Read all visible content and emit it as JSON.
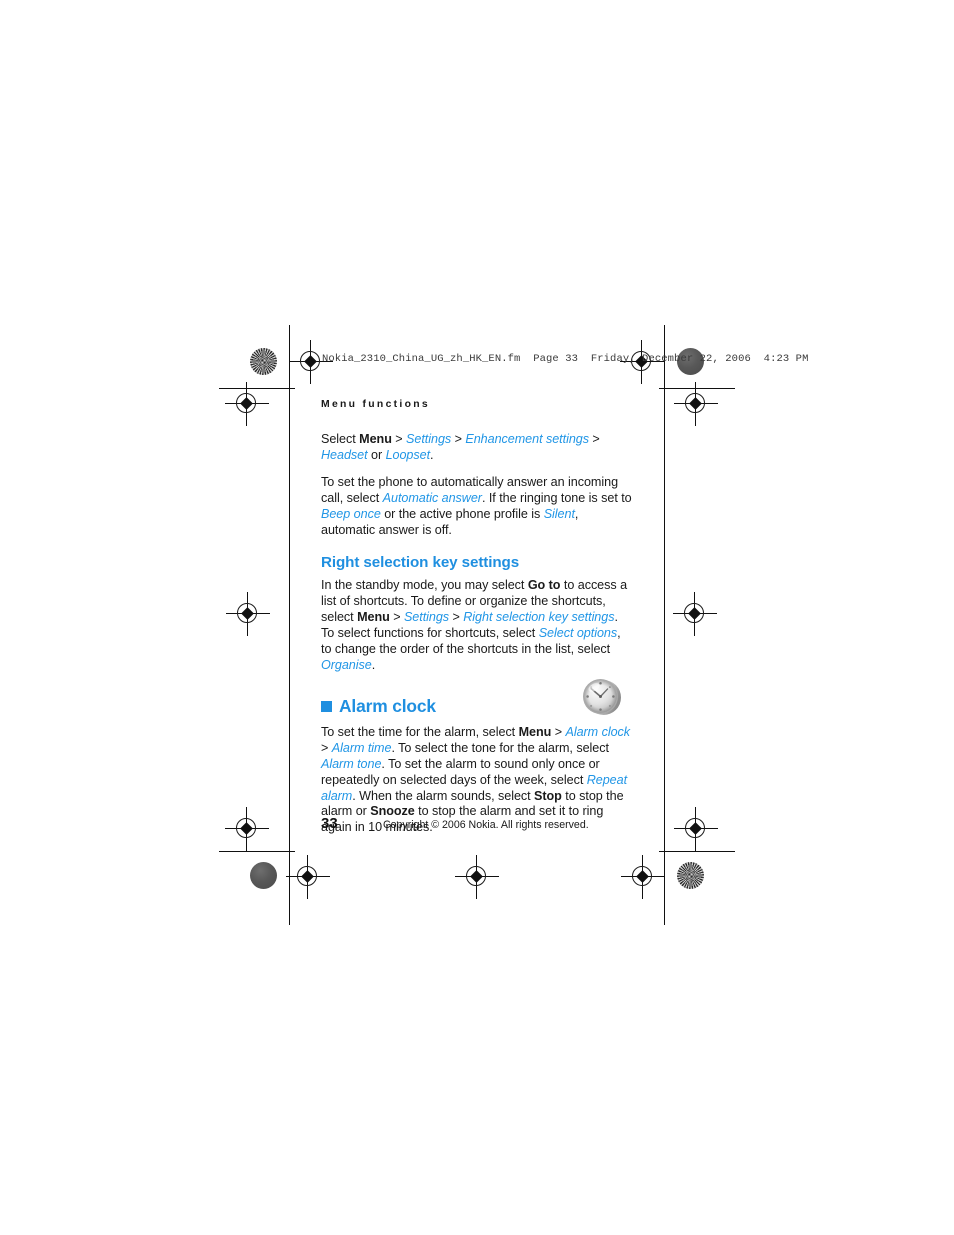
{
  "document": {
    "fm_header": "Nokia_2310_China_UG_zh_HK_EN.fm  Page 33  Friday, December 22, 2006  4:23 PM",
    "running_header": "Menu functions",
    "page_number": "33",
    "copyright": "Copyright © 2006 Nokia. All rights reserved.",
    "accent_color": "#1f8fe0",
    "link_color": "#2196e6",
    "text_color": "#1a1a1a"
  },
  "content": {
    "paragraph_1": {
      "segments": [
        {
          "text": "Select ",
          "style": "plain"
        },
        {
          "text": "Menu",
          "style": "bold"
        },
        {
          "text": " > ",
          "style": "plain"
        },
        {
          "text": "Settings",
          "style": "link"
        },
        {
          "text": " > ",
          "style": "plain"
        },
        {
          "text": "Enhancement settings",
          "style": "link"
        },
        {
          "text": " > ",
          "style": "plain"
        },
        {
          "text": "Headset",
          "style": "link"
        },
        {
          "text": " or ",
          "style": "plain"
        },
        {
          "text": "Loopset",
          "style": "link"
        },
        {
          "text": ".",
          "style": "plain"
        }
      ]
    },
    "paragraph_2": {
      "segments": [
        {
          "text": "To set the phone to automatically answer an incoming call, select ",
          "style": "plain"
        },
        {
          "text": "Automatic answer",
          "style": "link"
        },
        {
          "text": ". If the ringing tone is set to ",
          "style": "plain"
        },
        {
          "text": "Beep once",
          "style": "link"
        },
        {
          "text": " or the active phone profile is ",
          "style": "plain"
        },
        {
          "text": "Silent",
          "style": "link"
        },
        {
          "text": ", automatic answer is off.",
          "style": "plain"
        }
      ]
    },
    "section_heading": "Right selection key settings",
    "paragraph_3": {
      "segments": [
        {
          "text": "In the standby mode, you may select ",
          "style": "plain"
        },
        {
          "text": "Go to",
          "style": "bold"
        },
        {
          "text": " to access a list of shortcuts. To define or organize the shortcuts, select ",
          "style": "plain"
        },
        {
          "text": "Menu",
          "style": "bold"
        },
        {
          "text": " > ",
          "style": "plain"
        },
        {
          "text": "Settings",
          "style": "link"
        },
        {
          "text": " > ",
          "style": "plain"
        },
        {
          "text": "Right selection key settings",
          "style": "link"
        },
        {
          "text": ". To select functions for shortcuts, select ",
          "style": "plain"
        },
        {
          "text": "Select options",
          "style": "link"
        },
        {
          "text": ", to change the order of the shortcuts in the list, select ",
          "style": "plain"
        },
        {
          "text": "Organise",
          "style": "link"
        },
        {
          "text": ".",
          "style": "plain"
        }
      ]
    },
    "chapter_heading": "Alarm clock",
    "paragraph_4": {
      "segments": [
        {
          "text": "To set the time for the alarm, select ",
          "style": "plain"
        },
        {
          "text": "Menu",
          "style": "bold"
        },
        {
          "text": " > ",
          "style": "plain"
        },
        {
          "text": "Alarm clock",
          "style": "link"
        },
        {
          "text": " > ",
          "style": "plain"
        },
        {
          "text": "Alarm time",
          "style": "link"
        },
        {
          "text": ". To select the tone for the alarm, select ",
          "style": "plain"
        },
        {
          "text": "Alarm tone",
          "style": "link"
        },
        {
          "text": ". To set the alarm to sound only once or repeatedly on selected days of the week, select ",
          "style": "plain"
        },
        {
          "text": "Repeat alarm",
          "style": "link"
        },
        {
          "text": ". When the alarm sounds, select ",
          "style": "plain"
        },
        {
          "text": "Stop",
          "style": "bold"
        },
        {
          "text": " to stop the alarm or ",
          "style": "plain"
        },
        {
          "text": "Snooze",
          "style": "bold"
        },
        {
          "text": " to stop the alarm and set it to ring again in 10 minutes.",
          "style": "plain"
        }
      ]
    },
    "illustration": "alarm-clock-icon"
  }
}
